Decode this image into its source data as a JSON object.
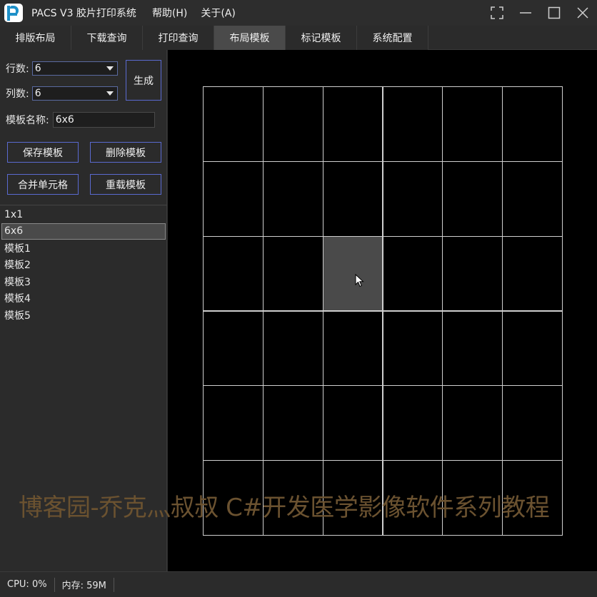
{
  "window": {
    "title": "PACS V3 胶片打印系统",
    "menu": [
      "帮助(H)",
      "关于(A)"
    ]
  },
  "tabs": [
    {
      "label": "排版布局",
      "active": false
    },
    {
      "label": "下载查询",
      "active": false
    },
    {
      "label": "打印查询",
      "active": false
    },
    {
      "label": "布局模板",
      "active": true
    },
    {
      "label": "标记模板",
      "active": false
    },
    {
      "label": "系统配置",
      "active": false
    }
  ],
  "form": {
    "rows_label": "行数:",
    "rows_value": "6",
    "cols_label": "列数:",
    "cols_value": "6",
    "generate_label": "生成",
    "name_label": "模板名称:",
    "name_value": "6x6"
  },
  "buttons": {
    "save": "保存模板",
    "delete": "删除模板",
    "merge": "合并单元格",
    "reload": "重载模板"
  },
  "templates": [
    "1x1",
    "6x6",
    "模板1",
    "模板2",
    "模板3",
    "模板4",
    "模板5"
  ],
  "selected_template": "6x6",
  "grid": {
    "rows": 6,
    "cols": 6,
    "highlight_row": 2,
    "highlight_col": 2
  },
  "watermark": "博客园-乔克灬叔叔 C#开发医学影像软件系列教程",
  "status": {
    "cpu": "CPU: 0%",
    "mem": "内存: 59M"
  },
  "colors": {
    "accent_border": "#5a6ad0",
    "highlight_cell": "#4a4a4a",
    "watermark": "#6b5230"
  }
}
